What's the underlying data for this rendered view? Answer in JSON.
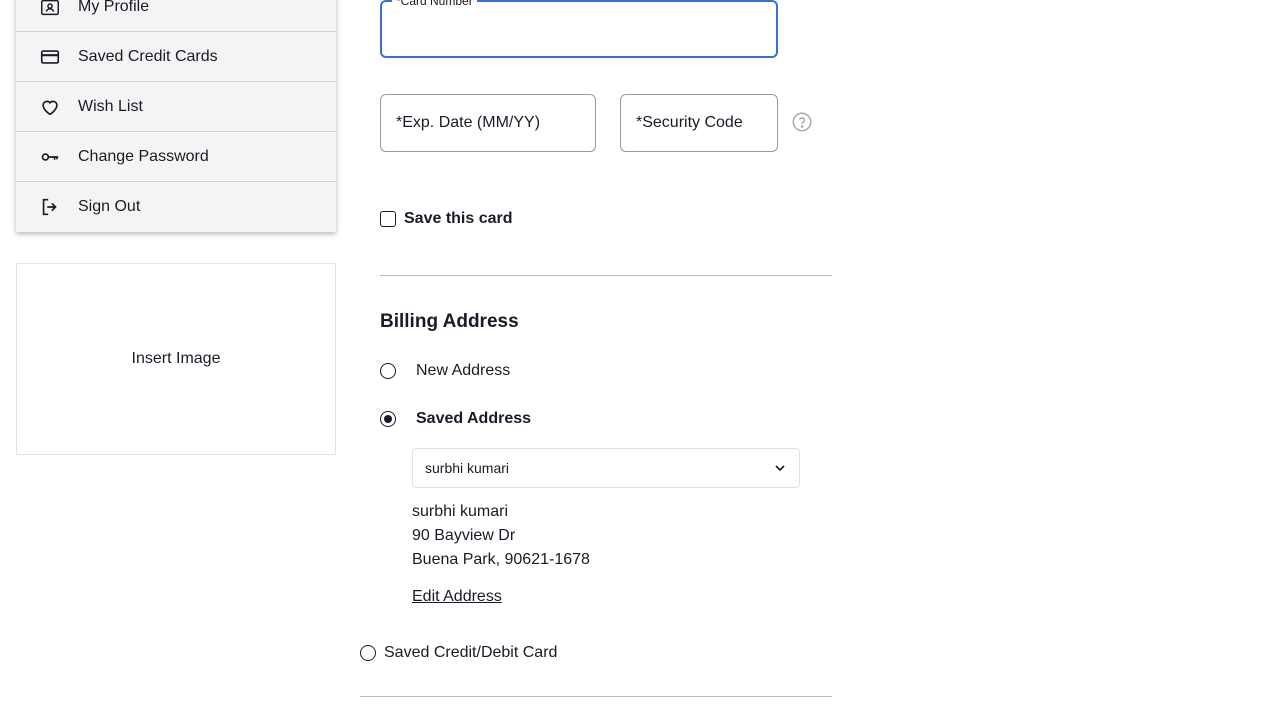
{
  "sidebar": {
    "items": [
      {
        "label": "My Profile",
        "icon": "profile-card-icon"
      },
      {
        "label": "Saved Credit Cards",
        "icon": "credit-card-icon"
      },
      {
        "label": "Wish List",
        "icon": "heart-icon"
      },
      {
        "label": "Change Password",
        "icon": "key-icon"
      },
      {
        "label": "Sign Out",
        "icon": "sign-out-icon"
      }
    ],
    "image_placeholder": "Insert Image"
  },
  "payment": {
    "card_number_label": "*Card Number",
    "card_number_value": "",
    "exp_date_placeholder": "*Exp. Date (MM/YY)",
    "security_code_placeholder": "*Security Code",
    "help_icon": "question-circle-icon",
    "save_card_label": "Save this card",
    "save_card_checked": false
  },
  "billing": {
    "title": "Billing Address",
    "new_address_label": "New Address",
    "saved_address_label": "Saved Address",
    "selected_option": "saved",
    "select_value": "surbhi kumari",
    "address_name": "surbhi kumari",
    "address_line1": "90 Bayview Dr",
    "address_line2": "Buena Park, 90621-1678",
    "edit_link": "Edit Address"
  },
  "payment_method": {
    "saved_card_label": "Saved Credit/Debit Card"
  },
  "colors": {
    "focus_border": "#3b6fd6",
    "text": "#1b1b28",
    "menu_bg": "#f4f4f4"
  }
}
